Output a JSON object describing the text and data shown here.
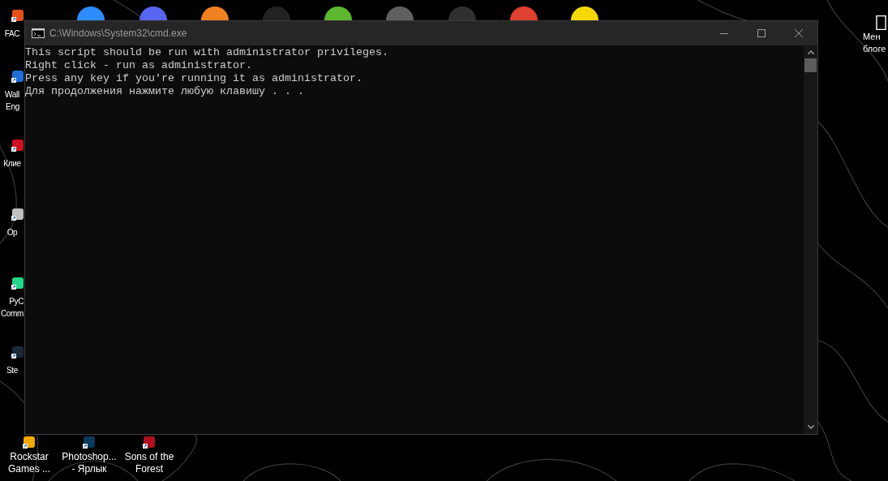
{
  "desktop": {
    "left_icons": [
      {
        "label": [
          "FAC"
        ]
      },
      {
        "label": [
          "Wall",
          "Eng"
        ]
      },
      {
        "label": [
          "Клие"
        ]
      },
      {
        "label": [
          "Op"
        ]
      },
      {
        "label": [
          "PyC",
          "Comm"
        ]
      },
      {
        "label": [
          "Ste"
        ]
      }
    ],
    "bottom_icons": [
      {
        "label": [
          "Rockstar",
          "Games ..."
        ]
      },
      {
        "label": [
          "Photoshop...",
          "- Ярлык"
        ]
      },
      {
        "label": [
          "Sons of the",
          "Forest"
        ]
      }
    ],
    "right_icons": [
      {
        "label": [
          "Мен",
          "блоге"
        ]
      }
    ]
  },
  "window": {
    "title": "C:\\Windows\\System32\\cmd.exe",
    "console_lines": [
      "This script should be run with administrator privileges.",
      "Right click - run as administrator.",
      "Press any key if you're running it as administrator.",
      "Для продолжения нажмите любую клавишу . . ."
    ]
  }
}
